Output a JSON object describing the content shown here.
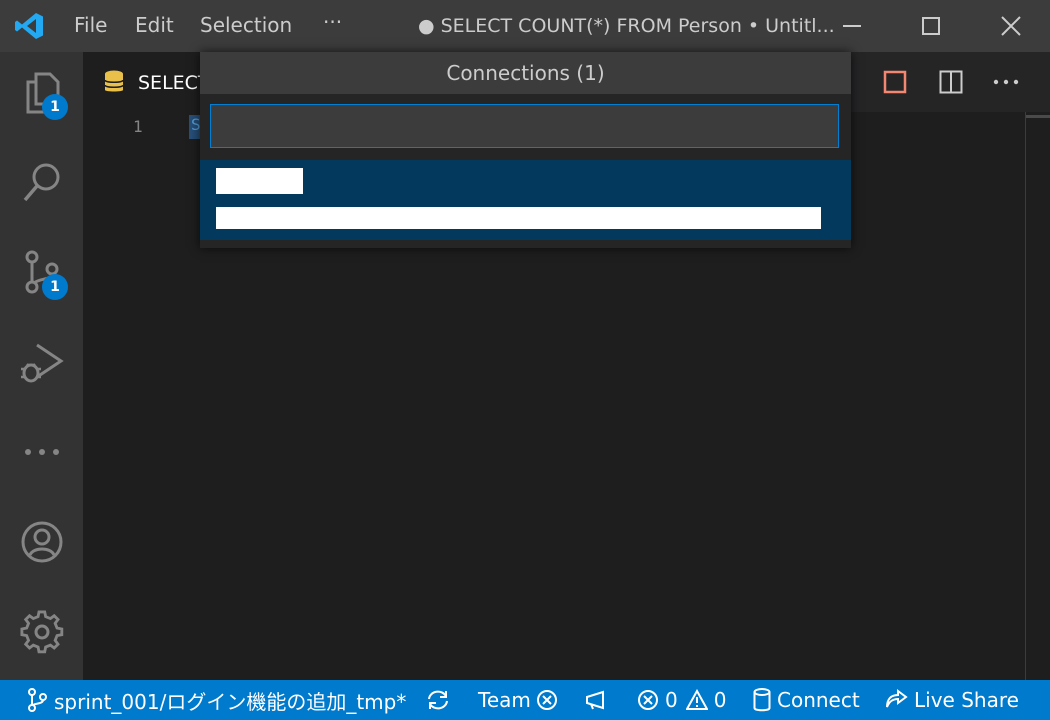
{
  "titlebar": {
    "menu": [
      "File",
      "Edit",
      "Selection",
      "···"
    ],
    "title": "● SELECT COUNT(*) FROM Person • Untitl..."
  },
  "activity": {
    "explorer_badge": "1",
    "scm_badge": "1"
  },
  "editor": {
    "tab_label": "SELECT",
    "line_number": "1",
    "first_char": "S"
  },
  "quickpick": {
    "title": "Connections (1)",
    "input_value": "",
    "items": [
      {
        "label": "",
        "detail": ""
      }
    ]
  },
  "statusbar": {
    "branch": "sprint_001/ログイン機能の追加_tmp*",
    "team": "Team",
    "errors": "0",
    "warnings": "0",
    "connect": "Connect",
    "live_share": "Live Share"
  },
  "colors": {
    "accent": "#007acc",
    "titlebar": "#3c3c3c",
    "activitybar": "#333333",
    "editor_bg": "#1e1e1e",
    "selection": "#04395e",
    "stop_icon": "#f48771"
  },
  "icons": [
    "vscode-logo-icon",
    "explorer-icon",
    "search-icon",
    "source-control-icon",
    "run-debug-icon",
    "more-icon",
    "account-icon",
    "gear-icon",
    "database-icon",
    "stop-icon",
    "split-editor-icon",
    "branch-icon",
    "sync-icon",
    "feedback-icon",
    "error-icon",
    "warning-icon",
    "live-share-icon"
  ]
}
